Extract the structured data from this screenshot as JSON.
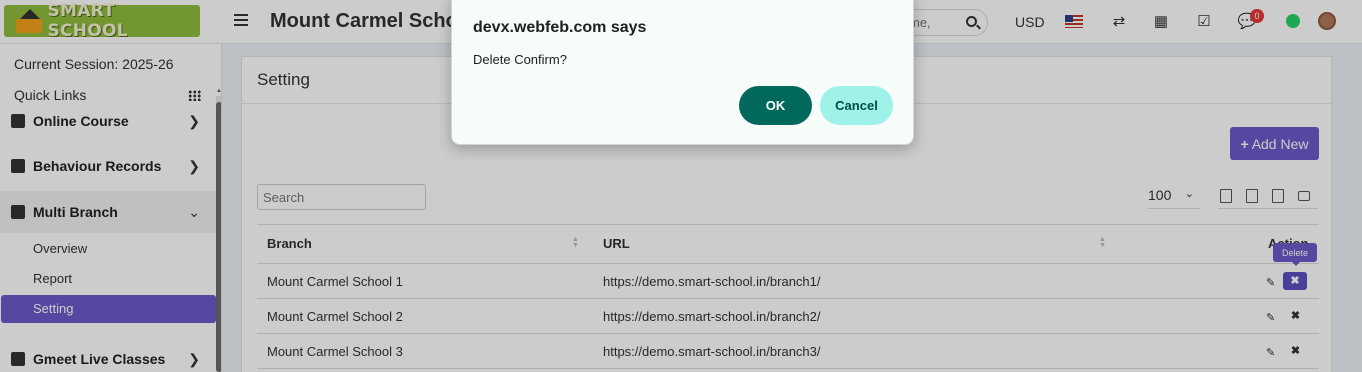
{
  "header": {
    "logo_text": "SMART SCHOOL",
    "school_name": "Mount Carmel School",
    "search_placeholder": "me,",
    "currency": "USD",
    "notification_count": "0"
  },
  "sidebar": {
    "session_label": "Current Session: 2025-26",
    "quick_links_label": "Quick Links",
    "items": [
      {
        "label": "Online Course",
        "icon": "document-icon"
      },
      {
        "label": "Behaviour Records",
        "icon": "signpost-icon"
      },
      {
        "label": "Multi Branch",
        "icon": "sitemap-icon"
      },
      {
        "label": "Gmeet Live Classes",
        "icon": "video-icon"
      }
    ],
    "sub_items": [
      "Overview",
      "Report",
      "Setting"
    ],
    "active_sub_item": "Setting"
  },
  "main": {
    "title": "Setting",
    "add_button_label": "Add New",
    "search_placeholder": "Search",
    "page_size": "100",
    "table": {
      "columns": [
        "Branch",
        "URL",
        "Action"
      ],
      "rows": [
        {
          "branch": "Mount Carmel School 1",
          "url": "https://demo.smart-school.in/branch1/"
        },
        {
          "branch": "Mount Carmel School 2",
          "url": "https://demo.smart-school.in/branch2/"
        },
        {
          "branch": "Mount Carmel School 3",
          "url": "https://demo.smart-school.in/branch3/"
        }
      ]
    },
    "tooltip": "Delete"
  },
  "dialog": {
    "title": "devx.webfeb.com says",
    "message": "Delete Confirm?",
    "ok_label": "OK",
    "cancel_label": "Cancel"
  },
  "colors": {
    "accent": "#6a5ac9",
    "ok_button": "#00695c",
    "cancel_button": "#9ff2e8",
    "logo_bg": "#8fbd3e"
  }
}
